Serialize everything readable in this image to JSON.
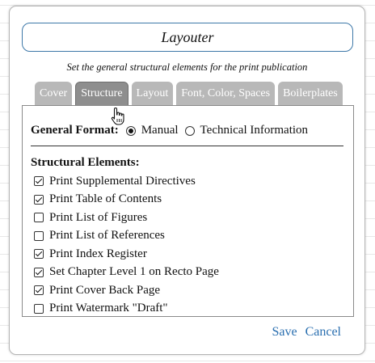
{
  "dialog": {
    "title": "Layouter",
    "subtitle": "Set the general structural elements for the print publication"
  },
  "tabs": [
    {
      "label": "Cover",
      "active": false
    },
    {
      "label": "Structure",
      "active": true
    },
    {
      "label": "Layout",
      "active": false
    },
    {
      "label": "Font, Color, Spaces",
      "active": false
    },
    {
      "label": "Boilerplates",
      "active": false
    }
  ],
  "general_format": {
    "label": "General Format:",
    "options": [
      {
        "label": "Manual",
        "selected": true
      },
      {
        "label": "Technical Information",
        "selected": false
      }
    ]
  },
  "structural_elements": {
    "heading": "Structural Elements:",
    "items": [
      {
        "label": "Print Supplemental Directives",
        "checked": true
      },
      {
        "label": "Print Table of Contents",
        "checked": true
      },
      {
        "label": "Print List of Figures",
        "checked": false
      },
      {
        "label": "Print List of References",
        "checked": false
      },
      {
        "label": "Print Index Register",
        "checked": true
      },
      {
        "label": "Set Chapter Level 1 on Recto Page",
        "checked": true
      },
      {
        "label": "Print Cover Back Page",
        "checked": true
      },
      {
        "label": "Print Watermark \"Draft\"",
        "checked": false
      }
    ]
  },
  "actions": {
    "save_label": "Save",
    "cancel_label": "Cancel"
  },
  "colors": {
    "accent": "#2a6fb0",
    "title_border": "#3d78a8",
    "tab_inactive": "#b8b8b8",
    "tab_active": "#8e8e8e"
  },
  "icons": {
    "cursor": "hand-pointer-icon"
  }
}
